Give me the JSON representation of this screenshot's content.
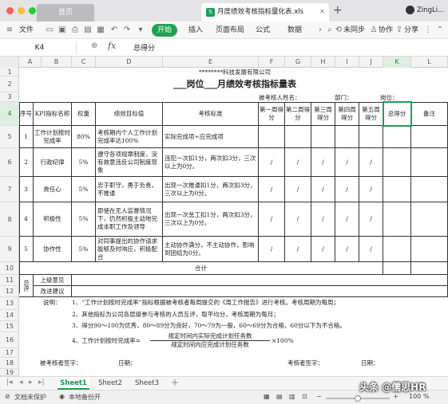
{
  "window": {
    "home_tab": "首页",
    "file_tab": "月度绩效考核指标量化表.xls",
    "user": "ZingLi...",
    "dots": [
      "#fe5f57",
      "#febc2e",
      "#28c840"
    ]
  },
  "menu": {
    "file": "文件",
    "start": "开始",
    "insert": "插入",
    "layout": "页面布局",
    "formula": "公式",
    "data": "数据",
    "sync": "未同步",
    "collab": "协作",
    "share": "分享"
  },
  "formula_bar": {
    "cell_ref": "K4",
    "fx": "fx",
    "content": "总得分"
  },
  "columns": [
    "A",
    "B",
    "C",
    "D",
    "E",
    "F",
    "G",
    "H",
    "I",
    "J",
    "K",
    "L"
  ],
  "rows": [
    "1",
    "2",
    "3",
    "4",
    "5",
    "6",
    "7",
    "8",
    "9",
    "10",
    "11",
    "12",
    "13",
    "14",
    "15",
    "16",
    "17",
    "18",
    "19"
  ],
  "sheet": {
    "company": "********科技发展有限公司",
    "title": "___岗位___月绩效考核指标量表",
    "examinee": "被考核人姓名：",
    "dept": "部门：",
    "post": "岗位：",
    "headers": {
      "no": "序号",
      "kpi": "KPI指标名称",
      "weight": "权重",
      "target": "绩效目标值",
      "standard": "考核标准",
      "w1": "第一周得分",
      "w2": "第二周得分",
      "w3": "第三周得分",
      "w4": "第四周得分",
      "w5": "第五周得分",
      "total": "总得分",
      "remark": "备注"
    },
    "items": [
      {
        "no": "1",
        "kpi": "工作计划按时完成率",
        "weight": "80%",
        "target": "考核期内个人工作计划完成率达100%",
        "standard": "实际完成项÷应完成项",
        "w1": "",
        "w2": "",
        "w3": "",
        "w4": "",
        "w5": ""
      },
      {
        "no": "2",
        "kpi": "行政纪律",
        "weight": "5%",
        "target": "遵守各项规章制度，没有故意违反公司制度现象",
        "standard": "违犯一次扣1分，两次扣3分，三次以上为0分。",
        "w1": "/",
        "w2": "/",
        "w3": "/",
        "w4": "/",
        "w5": "/"
      },
      {
        "no": "3",
        "kpi": "责任心",
        "weight": "5%",
        "target": "忠于职守，勇于负责，不推诿",
        "standard": "出现一次推诿扣1分，两次扣3分，三次以上为0分。",
        "w1": "/",
        "w2": "/",
        "w3": "/",
        "w4": "/",
        "w5": "/"
      },
      {
        "no": "4",
        "kpi": "积极性",
        "weight": "5%",
        "target": "即使在无人监督情况下，仍然积极主动地完成本职工作及领导",
        "standard": "出现一次怠工扣1分，两次扣3分，三次以上为0分。",
        "w1": "/",
        "w2": "/",
        "w3": "/",
        "w4": "/",
        "w5": "/"
      },
      {
        "no": "5",
        "kpi": "协作性",
        "weight": "5%",
        "target": "对同事提出的协作请求能够及时响应，积极配合",
        "standard": "主动协作满分，不主动协作，影响到团结为0分。",
        "w1": "/",
        "w2": "/",
        "w3": "/",
        "w4": "/",
        "w5": "/"
      }
    ],
    "total_label": "合计",
    "summary": "总评",
    "superior": "上级意见",
    "improve": "改进建议",
    "notes_label": "说明：",
    "notes": [
      "1、“工作计划按时完成率”指标根据被考核者每周提交的《周工作报告》进行考核。考核周期为每周；",
      "2、其他指标为公司各层级参与考核的人员互评，取平均分，考核周期为每月；",
      "3、得分90～100为优秀，80～89分为良好，70～79为一般，60～69分为合格，60分以下为不合格。",
      "4、工作计划按时完成率=",
      "规定时间内实际完成计划任务数",
      "规定时间内应完成计划任务数",
      "×100%"
    ],
    "sign_examinee": "被考核者签字：",
    "date1": "日期：",
    "sign_examiner": "考核者签字：",
    "date2": "日期："
  },
  "sheet_tabs": [
    "Sheet1",
    "Sheet2",
    "Sheet3"
  ],
  "status": {
    "protect": "文档未保护",
    "backup": "本地备份开",
    "zoom": "100 %",
    "zoom_level": 0.5
  },
  "watermark": "头条 @儒思HR"
}
